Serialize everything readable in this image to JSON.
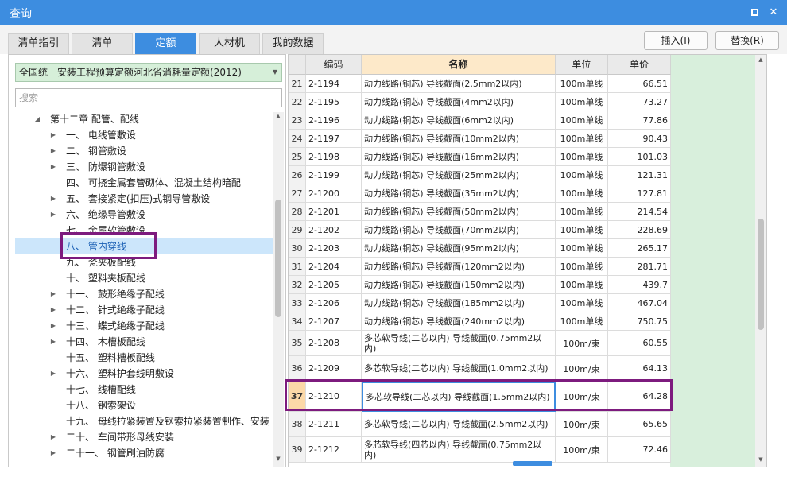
{
  "window": {
    "title": "查询"
  },
  "tabs": [
    {
      "label": "清单指引",
      "active": false
    },
    {
      "label": "清单",
      "active": false
    },
    {
      "label": "定额",
      "active": true
    },
    {
      "label": "人材机",
      "active": false
    },
    {
      "label": "我的数据",
      "active": false
    }
  ],
  "actions": {
    "insert": "插入(I)",
    "replace": "替换(R)"
  },
  "left": {
    "quota_library": "全国统一安装工程预算定额河北省消耗量定额(2012)",
    "search_placeholder": "搜索"
  },
  "tree": [
    {
      "label": "第十二章 配管、配线",
      "toggle": "expanded"
    },
    {
      "label": "一、 电线管敷设",
      "toggle": "collapsed"
    },
    {
      "label": "二、 钢管敷设",
      "toggle": "collapsed"
    },
    {
      "label": "三、 防爆钢管敷设",
      "toggle": "collapsed"
    },
    {
      "label": "四、 可挠金属套管砌体、混凝土结构暗配",
      "toggle": "none"
    },
    {
      "label": "五、 套接紧定(扣压)式钢导管敷设",
      "toggle": "collapsed"
    },
    {
      "label": "六、 绝缘导管敷设",
      "toggle": "collapsed"
    },
    {
      "label": "七、 金属软管敷设",
      "toggle": "none"
    },
    {
      "label": "八、 管内穿线",
      "toggle": "none",
      "selected": true
    },
    {
      "label": "九、 瓷夹板配线",
      "toggle": "none"
    },
    {
      "label": "十、 塑料夹板配线",
      "toggle": "none"
    },
    {
      "label": "十一、 鼓形绝缘子配线",
      "toggle": "collapsed"
    },
    {
      "label": "十二、 针式绝缘子配线",
      "toggle": "collapsed"
    },
    {
      "label": "十三、 蝶式绝缘子配线",
      "toggle": "collapsed"
    },
    {
      "label": "十四、 木槽板配线",
      "toggle": "collapsed"
    },
    {
      "label": "十五、 塑料槽板配线",
      "toggle": "none"
    },
    {
      "label": "十六、 塑料护套线明敷设",
      "toggle": "collapsed"
    },
    {
      "label": "十七、 线槽配线",
      "toggle": "none"
    },
    {
      "label": "十八、 钢索架设",
      "toggle": "none"
    },
    {
      "label": "十九、 母线拉紧装置及钢索拉紧装置制作、安装",
      "toggle": "none"
    },
    {
      "label": "二十、 车间带形母线安装",
      "toggle": "collapsed"
    },
    {
      "label": "二十一、 钢管刷油防腐",
      "toggle": "collapsed"
    }
  ],
  "grid": {
    "columns": {
      "code": "编码",
      "name": "名称",
      "unit": "单位",
      "price": "单价"
    },
    "rows": [
      {
        "idx": "21",
        "code": "2-1194",
        "name": "动力线路(铜芯) 导线截面(2.5mm2以内)",
        "unit": "100m单线",
        "price": "66.51"
      },
      {
        "idx": "22",
        "code": "2-1195",
        "name": "动力线路(铜芯) 导线截面(4mm2以内)",
        "unit": "100m单线",
        "price": "73.27"
      },
      {
        "idx": "23",
        "code": "2-1196",
        "name": "动力线路(铜芯) 导线截面(6mm2以内)",
        "unit": "100m单线",
        "price": "77.86"
      },
      {
        "idx": "24",
        "code": "2-1197",
        "name": "动力线路(铜芯) 导线截面(10mm2以内)",
        "unit": "100m单线",
        "price": "90.43"
      },
      {
        "idx": "25",
        "code": "2-1198",
        "name": "动力线路(铜芯) 导线截面(16mm2以内)",
        "unit": "100m单线",
        "price": "101.03"
      },
      {
        "idx": "26",
        "code": "2-1199",
        "name": "动力线路(铜芯) 导线截面(25mm2以内)",
        "unit": "100m单线",
        "price": "121.31"
      },
      {
        "idx": "27",
        "code": "2-1200",
        "name": "动力线路(铜芯) 导线截面(35mm2以内)",
        "unit": "100m单线",
        "price": "127.81"
      },
      {
        "idx": "28",
        "code": "2-1201",
        "name": "动力线路(铜芯) 导线截面(50mm2以内)",
        "unit": "100m单线",
        "price": "214.54"
      },
      {
        "idx": "29",
        "code": "2-1202",
        "name": "动力线路(铜芯) 导线截面(70mm2以内)",
        "unit": "100m单线",
        "price": "228.69"
      },
      {
        "idx": "30",
        "code": "2-1203",
        "name": "动力线路(铜芯) 导线截面(95mm2以内)",
        "unit": "100m单线",
        "price": "265.17"
      },
      {
        "idx": "31",
        "code": "2-1204",
        "name": "动力线路(铜芯) 导线截面(120mm2以内)",
        "unit": "100m单线",
        "price": "281.71"
      },
      {
        "idx": "32",
        "code": "2-1205",
        "name": "动力线路(铜芯) 导线截面(150mm2以内)",
        "unit": "100m单线",
        "price": "439.7"
      },
      {
        "idx": "33",
        "code": "2-1206",
        "name": "动力线路(铜芯) 导线截面(185mm2以内)",
        "unit": "100m单线",
        "price": "467.04"
      },
      {
        "idx": "34",
        "code": "2-1207",
        "name": "动力线路(铜芯) 导线截面(240mm2以内)",
        "unit": "100m单线",
        "price": "750.75"
      },
      {
        "idx": "35",
        "code": "2-1208",
        "name": "多芯软导线(二芯以内) 导线截面(0.75mm2以内)",
        "unit": "100m/束",
        "price": "60.55"
      },
      {
        "idx": "36",
        "code": "2-1209",
        "name": "多芯软导线(二芯以内) 导线截面(1.0mm2以内)",
        "unit": "100m/束",
        "price": "64.13"
      },
      {
        "idx": "37",
        "code": "2-1210",
        "name": "多芯软导线(二芯以内) 导线截面(1.5mm2以内)",
        "unit": "100m/束",
        "price": "64.28",
        "current": true
      },
      {
        "idx": "38",
        "code": "2-1211",
        "name": "多芯软导线(二芯以内) 导线截面(2.5mm2以内)",
        "unit": "100m/束",
        "price": "65.65"
      },
      {
        "idx": "39",
        "code": "2-1212",
        "name": "多芯软导线(四芯以内) 导线截面(0.75mm2以内)",
        "unit": "100m/束",
        "price": "72.46"
      }
    ]
  },
  "colors": {
    "accent": "#3d8de0",
    "highlight": "#7d1b7e",
    "green_panel": "#d8efdc",
    "name_header": "#fde9c9"
  }
}
